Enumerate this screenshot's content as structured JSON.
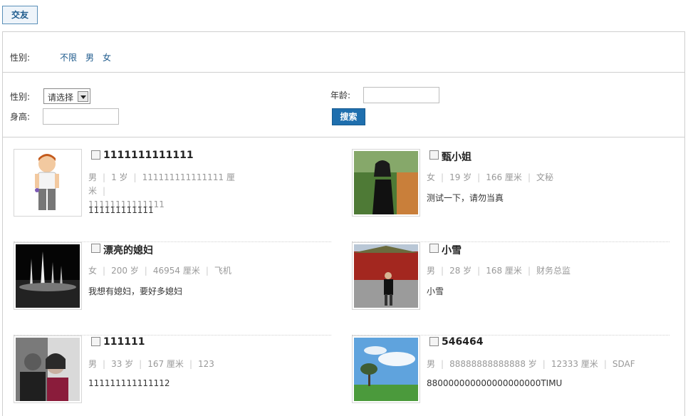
{
  "tab": {
    "label": "交友"
  },
  "filter": {
    "gender_label": "性别:",
    "options": [
      "不限",
      "男",
      "女"
    ]
  },
  "search": {
    "gender_label": "性别:",
    "gender_select": "请选择",
    "age_label": "年龄:",
    "height_label": "身高:",
    "search_button": "搜索"
  },
  "profiles": [
    {
      "name": "1111111111111",
      "gender": "男",
      "age": "1 岁",
      "height": "111111111111111 厘米",
      "job": "11111111111111",
      "signature": "111111111111"
    },
    {
      "name": "甄小姐",
      "gender": "女",
      "age": "19 岁",
      "height": "166 厘米",
      "job": "文秘",
      "signature": "测试一下，请勿当真"
    },
    {
      "name": "漂亮的媳妇",
      "gender": "女",
      "age": "200 岁",
      "height": "46954 厘米",
      "job": "飞机",
      "signature": "我想有媳妇，要好多媳妇"
    },
    {
      "name": "小雪",
      "gender": "男",
      "age": "28 岁",
      "height": "168 厘米",
      "job": "财务总监",
      "signature": "小雪"
    },
    {
      "name": "111111",
      "gender": "男",
      "age": "33 岁",
      "height": "167 厘米",
      "job": "123",
      "signature": "111111111111112"
    },
    {
      "name": "546464",
      "gender": "男",
      "age": "88888888888888 岁",
      "height": "12333 厘米",
      "job": "SDAF",
      "signature": "880000000000000000000TIMU"
    }
  ]
}
